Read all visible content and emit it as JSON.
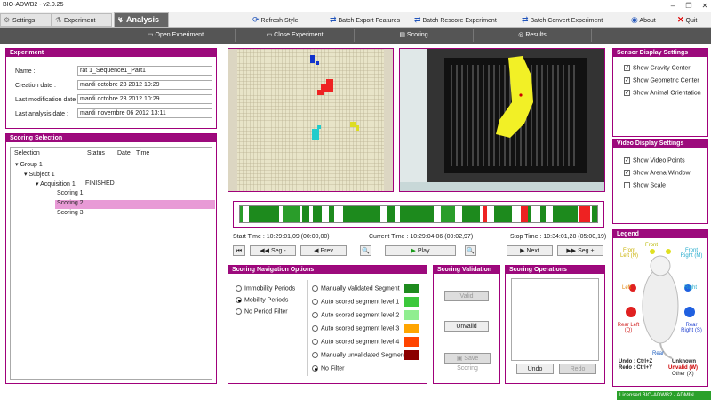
{
  "window": {
    "title": "BIO-ADWB2 - v2.0.25"
  },
  "menu": {
    "settings": "Settings",
    "experiment": "Experiment",
    "analysis": "Analysis",
    "refresh_style": "Refresh Style",
    "batch_export": "Batch Export Features",
    "batch_rescore": "Batch Rescore Experiment",
    "batch_convert": "Batch Convert Experiment",
    "about": "About",
    "quit": "Quit"
  },
  "subbar": {
    "open": "Open Experiment",
    "close": "Close Experiment",
    "scoring": "Scoring",
    "results": "Results"
  },
  "experiment": {
    "title": "Experiment",
    "fields": [
      {
        "label": "Name :",
        "value": "rat 1_Sequence1_Part1"
      },
      {
        "label": "Creation date :",
        "value": "mardi octobre 23 2012 10:29"
      },
      {
        "label": "Last modification date :",
        "value": "mardi octobre 23 2012 10:29"
      },
      {
        "label": "Last analysis date :",
        "value": "mardi novembre 06 2012 13:11"
      }
    ]
  },
  "scoring_selection": {
    "title": "Scoring Selection",
    "columns": [
      "Selection",
      "Status",
      "Date",
      "Time"
    ],
    "tree": [
      {
        "label": "Group 1",
        "status": ""
      },
      {
        "label": "Subject 1",
        "status": ""
      },
      {
        "label": "Acquisition 1",
        "status": "FINISHED"
      },
      {
        "label": "Scoring 1",
        "status": ""
      },
      {
        "label": "Scoring 2",
        "status": ""
      },
      {
        "label": "Scoring 3",
        "status": ""
      }
    ]
  },
  "timeline": {
    "start_label": "Start Time :",
    "start_value": "10:29:01,09  (00:00,00)",
    "current_label": "Current Time :",
    "current_value": "10:29:04,06  (00:02,97)",
    "stop_label": "Stop Time :",
    "stop_value": "10:34:01,28  (05:00,19)",
    "seg_minus": "Seg -",
    "prev": "Prev",
    "play": "Play",
    "next": "Next",
    "seg_plus": "Seg +"
  },
  "nav_options": {
    "title": "Scoring Navigation Options",
    "periods": [
      "Immobility Periods",
      "Mobility Periods",
      "No Period Filter"
    ],
    "selected_period": 1,
    "filters": [
      {
        "label": "Manually Validated Segment",
        "color": "#1e8b1e"
      },
      {
        "label": "Auto scored segment level 1",
        "color": "#3cc83c"
      },
      {
        "label": "Auto scored segment level 2",
        "color": "#90ee90"
      },
      {
        "label": "Auto scored segment level 3",
        "color": "#ffa500"
      },
      {
        "label": "Auto scored segment level 4",
        "color": "#ff4500"
      },
      {
        "label": "Manually unvalidated Segment",
        "color": "#8b0000"
      },
      {
        "label": "No Filter",
        "color": ""
      }
    ]
  },
  "validation": {
    "title": "Scoring Validation",
    "valid": "Valid",
    "unvalid": "Unvalid",
    "save": "Save Scoring"
  },
  "operations": {
    "title": "Scoring Operations",
    "undo": "Undo",
    "redo": "Redo"
  },
  "sensor": {
    "title": "Sensor Display Settings",
    "items": [
      {
        "label": "Show Gravity Center",
        "checked": true
      },
      {
        "label": "Show Geometric Center",
        "checked": true
      },
      {
        "label": "Show Animal Orientation",
        "checked": true
      }
    ]
  },
  "video": {
    "title": "Video Display Settings",
    "items": [
      {
        "label": "Show Video Points",
        "checked": true
      },
      {
        "label": "Show Arena Window",
        "checked": true
      },
      {
        "label": "Show Scale",
        "checked": false
      }
    ]
  },
  "legend": {
    "title": "Legend",
    "front": "Front",
    "front_left": "Front Left (N)",
    "front_right": "Front Right (M)",
    "left": "Left",
    "right": "Right",
    "rear_left": "Rear Left (Q)",
    "rear_right": "Rear Right (S)",
    "rear": "Rear",
    "undo": "Undo : Ctrl+Z",
    "redo": "Redo : Ctrl+Y",
    "unknown": "Unknown",
    "unvalid": "Unvalid (W)",
    "other": "Other (X)"
  },
  "status": {
    "license": "Licensed BIO-ADWB2 - ADMIN MODE"
  },
  "colors": {
    "accent": "#9c0a7c",
    "status_bg": "#2aa02a"
  }
}
